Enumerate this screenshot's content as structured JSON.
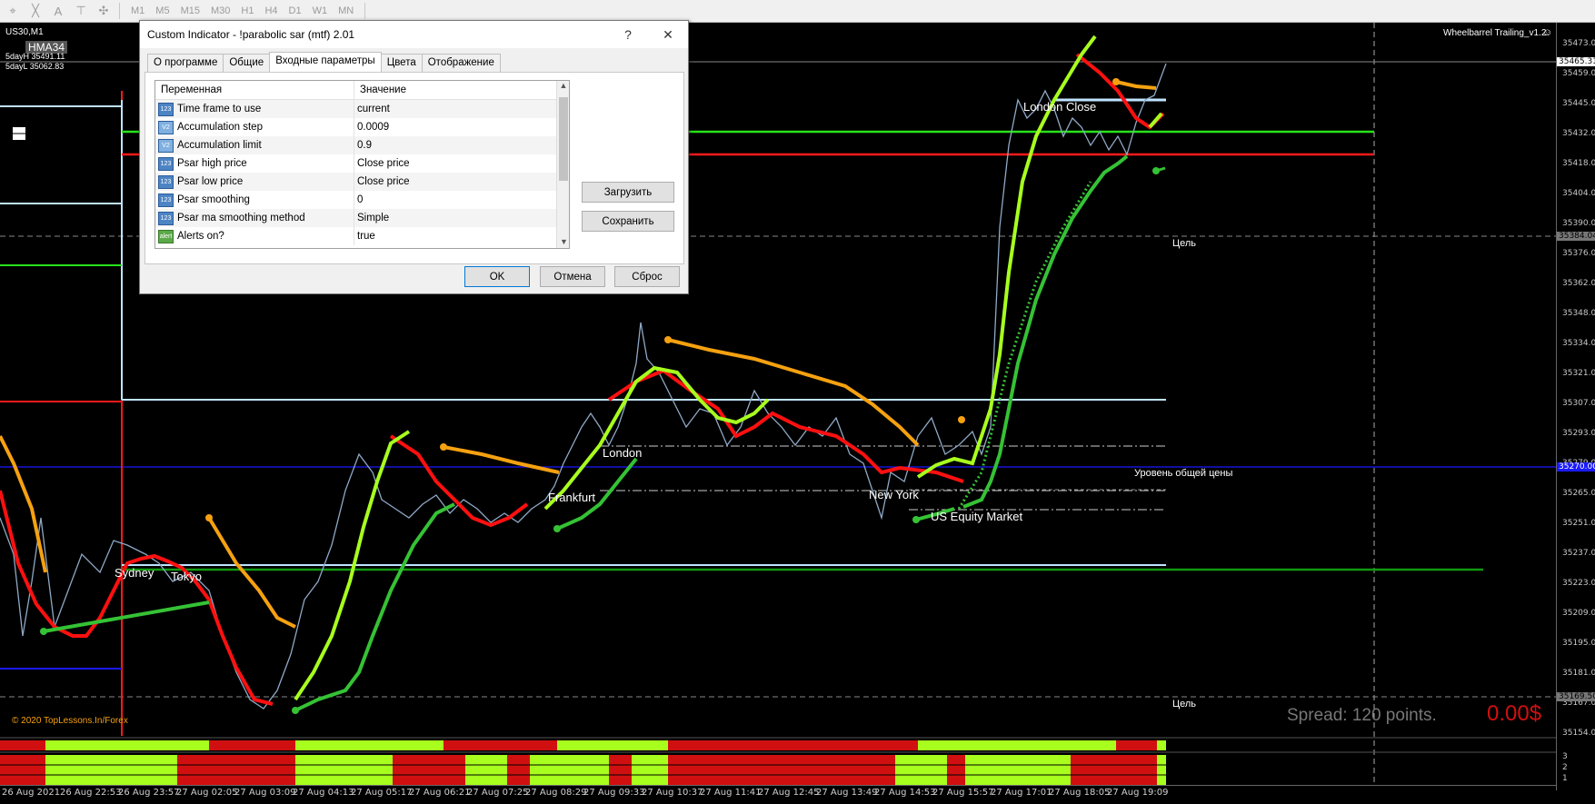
{
  "toolbar": {
    "tools": [
      "cursor-icon",
      "crosshair-icon",
      "text-icon",
      "label-icon",
      "shapes-icon"
    ],
    "timeframes": [
      "M1",
      "M5",
      "M15",
      "M30",
      "H1",
      "H4",
      "D1",
      "W1",
      "MN"
    ]
  },
  "chart": {
    "symbol": "US30,M1",
    "hma_label": "HMA34",
    "day_high": "5dayH 35491.11",
    "day_low": "5dayL 35062.83",
    "indicator_title": "Wheelbarrel Trailing_v1.2",
    "copyright": "© 2020 TopLessons.In/Forex",
    "spread": "Spread: 120 points.",
    "profit": "0.00$",
    "sessions": {
      "sydney": "Sydney",
      "tokyo": "Tokyo",
      "frankfurt": "Frankfurt",
      "london": "London",
      "new_york": "New York",
      "us_equity": "US Equity Market",
      "london_close": "London Close"
    },
    "target_top": "Цель",
    "target_bottom": "Цель",
    "general_level": "Уровень общей цены",
    "price_axis": [
      "35473.00",
      "35459.00",
      "35445.00",
      "35432.00",
      "35418.00",
      "35404.00",
      "35390.00",
      "35376.00",
      "35362.00",
      "35348.00",
      "35334.00",
      "35321.00",
      "35307.00",
      "35293.00",
      "35279.00",
      "35265.00",
      "35251.00",
      "35237.00",
      "35223.00",
      "35209.00",
      "35195.00",
      "35181.00",
      "35167.00",
      "35154.00"
    ],
    "price_tags": {
      "current": "35465.31",
      "target": "35384.04",
      "level": "35270.00",
      "low_target": "35169.50"
    },
    "subwindow_scale": [
      "3",
      "2",
      "1"
    ],
    "time_axis": [
      "26 Aug 2021",
      "26 Aug 22:53",
      "26 Aug 23:57",
      "27 Aug 02:05",
      "27 Aug 03:09",
      "27 Aug 04:13",
      "27 Aug 05:17",
      "27 Aug 06:21",
      "27 Aug 07:25",
      "27 Aug 08:29",
      "27 Aug 09:33",
      "27 Aug 10:37",
      "27 Aug 11:41",
      "27 Aug 12:45",
      "27 Aug 13:49",
      "27 Aug 14:53",
      "27 Aug 15:57",
      "27 Aug 17:01",
      "27 Aug 18:05",
      "27 Aug 19:09"
    ]
  },
  "dialog": {
    "title": "Custom Indicator - !parabolic sar (mtf) 2.01",
    "help": "?",
    "close": "✕",
    "tabs": [
      "О программе",
      "Общие",
      "Входные параметры",
      "Цвета",
      "Отображение"
    ],
    "active_tab": "Входные параметры",
    "columns": [
      "Переменная",
      "Значение"
    ],
    "rows": [
      {
        "icon": "123",
        "name": "Time frame to use",
        "value": "current"
      },
      {
        "icon": "V2",
        "name": "Accumulation step",
        "value": "0.0009"
      },
      {
        "icon": "V2",
        "name": "Accumulation limit",
        "value": "0.9"
      },
      {
        "icon": "123",
        "name": "Psar high price",
        "value": "Close price"
      },
      {
        "icon": "123",
        "name": "Psar low price",
        "value": "Close price"
      },
      {
        "icon": "123",
        "name": "Psar smoothing",
        "value": "0"
      },
      {
        "icon": "123",
        "name": "Psar ma smoothing method",
        "value": "Simple"
      },
      {
        "icon": "alert",
        "name": "Alerts on?",
        "value": "true"
      }
    ],
    "load": "Загрузить",
    "save": "Сохранить",
    "ok": "OK",
    "cancel": "Отмена",
    "reset": "Сброс"
  }
}
